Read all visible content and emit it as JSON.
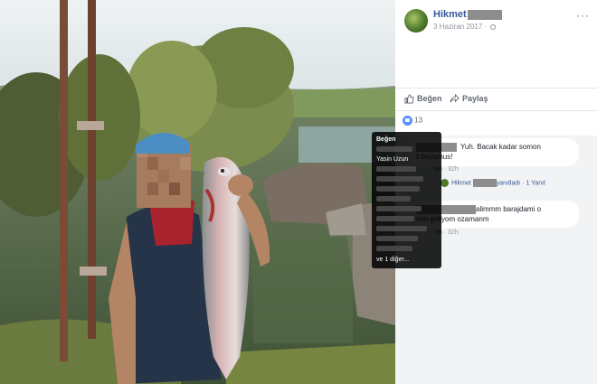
{
  "post": {
    "author_name": "Hikmet",
    "date": "3 Haziran 2017 ·",
    "more_label": "···"
  },
  "actions": {
    "like_label": "Beğen",
    "share_label": "Paylaş"
  },
  "reactions": {
    "count": "13"
  },
  "tooltip": {
    "title": "Beğen",
    "named_user": "Yasin Uzun",
    "more_label": "ve 1 diğer..."
  },
  "comments": [
    {
      "text_line1": "Yuh. Bacak kadar somon",
      "text_line2": "il buyumus!",
      "meta_prefix": "en",
      "time": "32h"
    },
    {
      "text_line1": "alimmm barajdami o",
      "text_line2": "nen geliyom ozamanm",
      "meta_prefix": "en",
      "time": "32h"
    }
  ],
  "reply": {
    "name": "Hikmet",
    "action": "yanıtladı",
    "count_label": "1 Yanıt"
  },
  "colors": {
    "link": "#365899",
    "like": "#5890ff",
    "comment_bg": "#f2f3f5"
  },
  "icons": [
    "like-icon",
    "share-icon",
    "globe-icon",
    "more-icon"
  ]
}
